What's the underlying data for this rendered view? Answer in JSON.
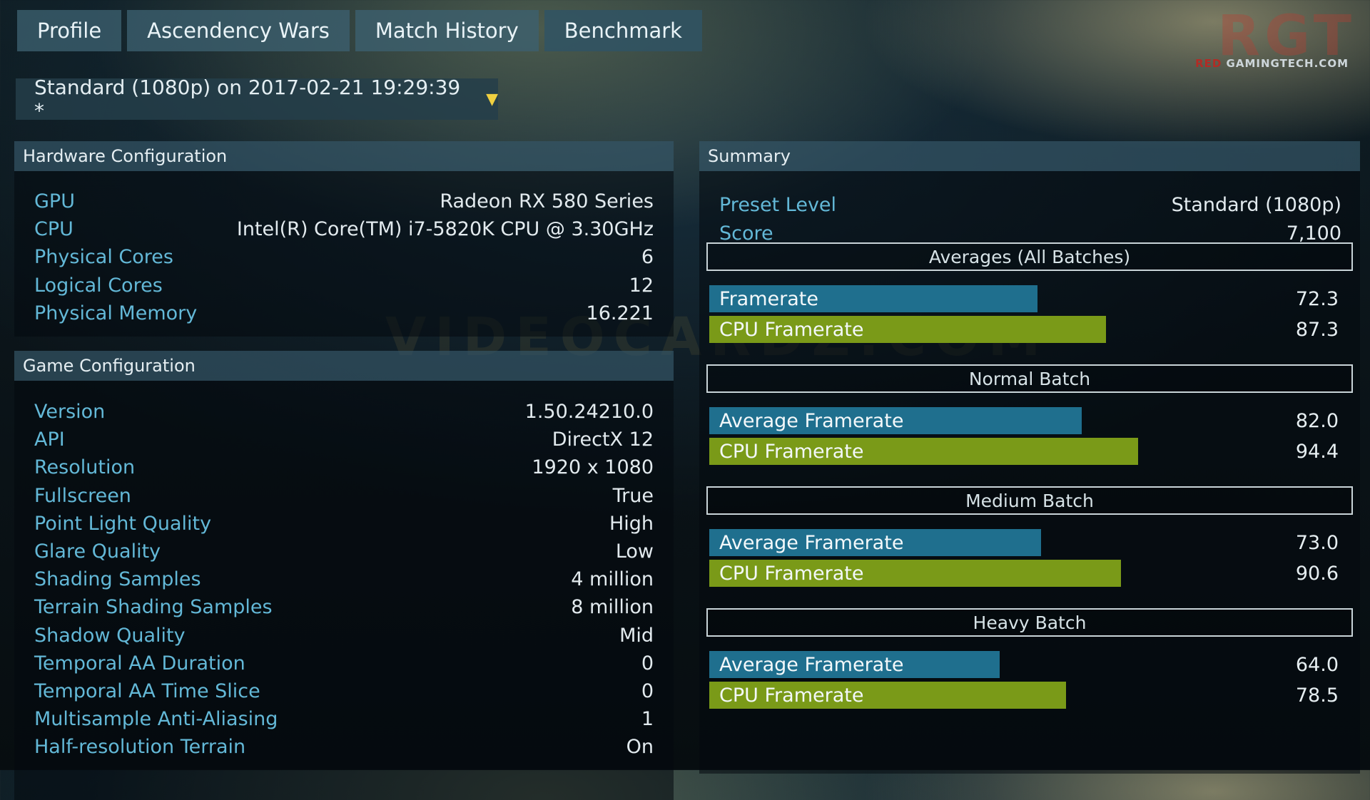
{
  "tabs": [
    {
      "label": "Profile"
    },
    {
      "label": "Ascendency Wars"
    },
    {
      "label": "Match History"
    },
    {
      "label": "Benchmark"
    }
  ],
  "brand": {
    "red": "RED",
    "rest": " GAMINGTECH.COM",
    "big": "RGT"
  },
  "run_selector": {
    "label": "Standard (1080p) on 2017-02-21 19:29:39 *",
    "caret": "▼"
  },
  "hardware": {
    "title": "Hardware Configuration",
    "rows": [
      {
        "k": "GPU",
        "v": "Radeon RX 580 Series"
      },
      {
        "k": "CPU",
        "v": "Intel(R) Core(TM) i7-5820K CPU @ 3.30GHz"
      },
      {
        "k": "Physical Cores",
        "v": "6"
      },
      {
        "k": "Logical Cores",
        "v": "12"
      },
      {
        "k": "Physical Memory",
        "v": "16.221"
      }
    ]
  },
  "game": {
    "title": "Game Configuration",
    "rows": [
      {
        "k": "Version",
        "v": "1.50.24210.0"
      },
      {
        "k": "API",
        "v": "DirectX 12"
      },
      {
        "k": "Resolution",
        "v": "1920 x 1080"
      },
      {
        "k": "Fullscreen",
        "v": "True"
      },
      {
        "k": "Point Light Quality",
        "v": "High"
      },
      {
        "k": "Glare Quality",
        "v": "Low"
      },
      {
        "k": "Shading Samples",
        "v": "4 million"
      },
      {
        "k": "Terrain Shading Samples",
        "v": "8 million"
      },
      {
        "k": "Shadow Quality",
        "v": "Mid"
      },
      {
        "k": "Temporal AA Duration",
        "v": "0"
      },
      {
        "k": "Temporal AA Time Slice",
        "v": "0"
      },
      {
        "k": "Multisample Anti-Aliasing",
        "v": "1"
      },
      {
        "k": "Half-resolution Terrain",
        "v": "On"
      }
    ]
  },
  "summary": {
    "title": "Summary",
    "preset_label": "Preset Level",
    "preset_value": "Standard (1080p)",
    "score_label": "Score",
    "score_value": "7,100",
    "bar_max": 110,
    "batches": [
      {
        "title": "Averages (All Batches)",
        "bars": [
          {
            "label": "Framerate",
            "value": 72.3,
            "display": "72.3",
            "color": "blue"
          },
          {
            "label": "CPU Framerate",
            "value": 87.3,
            "display": "87.3",
            "color": "green"
          }
        ]
      },
      {
        "title": "Normal Batch",
        "bars": [
          {
            "label": "Average Framerate",
            "value": 82.0,
            "display": "82.0",
            "color": "blue"
          },
          {
            "label": "CPU Framerate",
            "value": 94.4,
            "display": "94.4",
            "color": "green"
          }
        ]
      },
      {
        "title": "Medium Batch",
        "bars": [
          {
            "label": "Average Framerate",
            "value": 73.0,
            "display": "73.0",
            "color": "blue"
          },
          {
            "label": "CPU Framerate",
            "value": 90.6,
            "display": "90.6",
            "color": "green"
          }
        ]
      },
      {
        "title": "Heavy Batch",
        "bars": [
          {
            "label": "Average Framerate",
            "value": 64.0,
            "display": "64.0",
            "color": "blue"
          },
          {
            "label": "CPU Framerate",
            "value": 78.5,
            "display": "78.5",
            "color": "green"
          }
        ]
      }
    ]
  },
  "watermark": "VIDEOCARDZ.COM"
}
